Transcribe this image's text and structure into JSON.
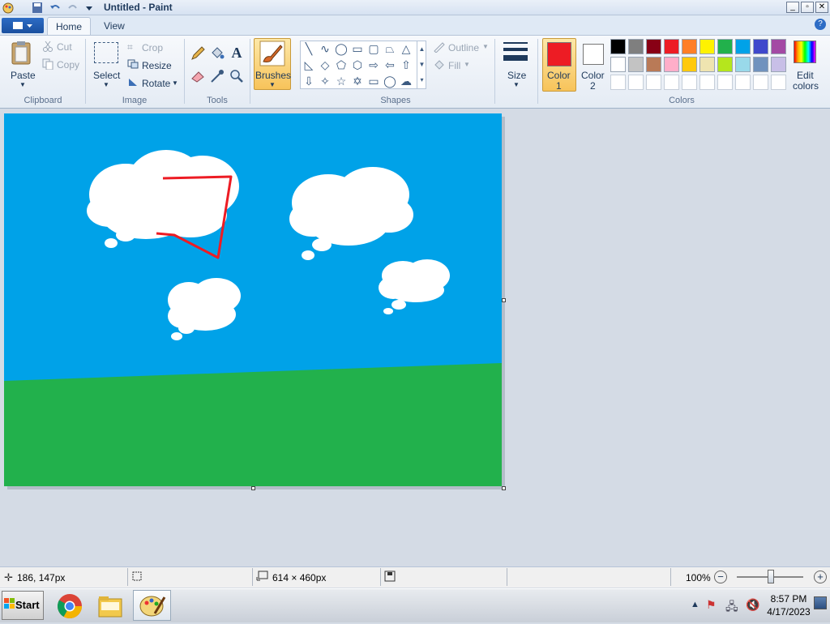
{
  "window": {
    "title": "Untitled - Paint"
  },
  "tabs": [
    "Home",
    "View"
  ],
  "clipboard": {
    "paste": "Paste",
    "cut": "Cut",
    "copy": "Copy",
    "label": "Clipboard"
  },
  "image": {
    "select": "Select",
    "crop": "Crop",
    "resize": "Resize",
    "rotate": "Rotate",
    "label": "Image"
  },
  "tools": {
    "label": "Tools"
  },
  "brushes": {
    "label": "Brushes"
  },
  "shapes": {
    "outline": "Outline",
    "fill": "Fill",
    "label": "Shapes"
  },
  "size": {
    "label": "Size"
  },
  "color1": {
    "label_a": "Color",
    "label_b": "1",
    "value": "#ed1c24"
  },
  "color2": {
    "label_a": "Color",
    "label_b": "2",
    "value": "#ffffff"
  },
  "colors": {
    "label": "Colors",
    "edit_a": "Edit",
    "edit_b": "colors",
    "palette_row1": [
      "#000000",
      "#7f7f7f",
      "#880015",
      "#ed1c24",
      "#ff7f27",
      "#fff200",
      "#22b14c",
      "#00a2e8",
      "#3f48cc",
      "#a349a4"
    ],
    "palette_row2": [
      "#ffffff",
      "#c3c3c3",
      "#b97a57",
      "#ffaec9",
      "#ffc90e",
      "#efe4b0",
      "#b5e61d",
      "#99d9ea",
      "#7092be",
      "#c8bfe7"
    ]
  },
  "canvas": {
    "sky": "#00a2e8",
    "grass": "#22b14c",
    "stroke": "#ed1c24"
  },
  "status": {
    "cursor": "186, 147px",
    "canvas_size": "614 × 460px",
    "zoom": "100%"
  },
  "taskbar": {
    "start": "Start",
    "time": "8:57 PM",
    "date": "4/17/2023"
  }
}
